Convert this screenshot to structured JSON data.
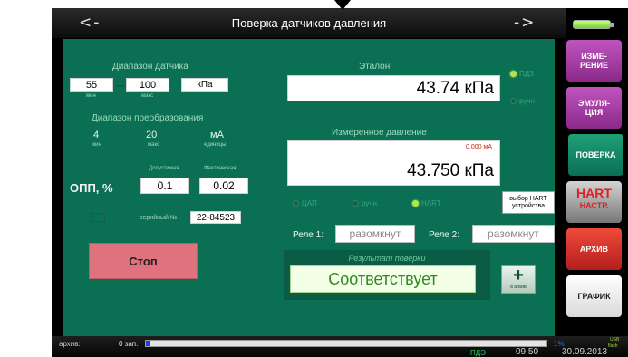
{
  "window": {
    "title": "Поверка датчиков давления",
    "prev": "<-",
    "next": "->"
  },
  "sensor_range": {
    "label": "Диапазон датчика",
    "min": "55",
    "min_sub": "мин",
    "max": "100",
    "max_sub": "макс",
    "unit": "кПа"
  },
  "conversion_range": {
    "label": "Диапазон преобразования",
    "min": "4",
    "min_sub": "мин",
    "max": "20",
    "max_sub": "макс",
    "unit": "мА",
    "unit_sub": "единицы"
  },
  "opp": {
    "label": "ОПП, %",
    "allowed_label": "Допустимая",
    "actual_label": "Фактическая",
    "allowed": "0.1",
    "actual": "0.02"
  },
  "serial": {
    "label": "серийный №",
    "value": "22-84523"
  },
  "reference": {
    "label": "Эталон",
    "value": "43.74 кПа",
    "opt_pdz": "ПДЗ",
    "opt_manual": "ручн.",
    "selected": "ПДЗ"
  },
  "measured": {
    "label": "Измеренное давление",
    "current": "0.000 мА",
    "value": "43.750 кПа",
    "opt_tsap": "ЦАП",
    "opt_manual": "ручн.",
    "opt_hart": "HART",
    "selected": "HART"
  },
  "hart_select": {
    "label": "выбор HART устройства"
  },
  "relay1": {
    "label": "Реле 1:",
    "value": "разомкнут"
  },
  "relay2": {
    "label": "Реле 2:",
    "value": "разомкнут"
  },
  "verification": {
    "label": "Результат поверки",
    "value": "Соответствует"
  },
  "add_archive": {
    "icon": "plus",
    "label": "в архив"
  },
  "stop": {
    "label": "Стоп"
  },
  "sidebar": {
    "measure": "ИЗМЕ-\nРЕНИЕ",
    "emulation": "ЭМУЛЯ-\nЦИЯ",
    "verify": "ПОВЕРКА",
    "hart_setup": "HART",
    "hart_setup_sub": "НАСТР.",
    "archive": "АРХИВ",
    "graph": "ГРАФИК"
  },
  "status": {
    "archive_label": "архив:",
    "archive_count": "0 зап.",
    "progress_fraction": 0.01,
    "percent": "1%",
    "indicator": "ПДЭ",
    "time": "09:50",
    "date": "30.09.2013",
    "corner_top": "USB",
    "corner_bottom": "flash"
  },
  "colors": {
    "panel": "#0b6f53",
    "stop_button": "#e0717f",
    "accent_green": "#aee64a"
  }
}
